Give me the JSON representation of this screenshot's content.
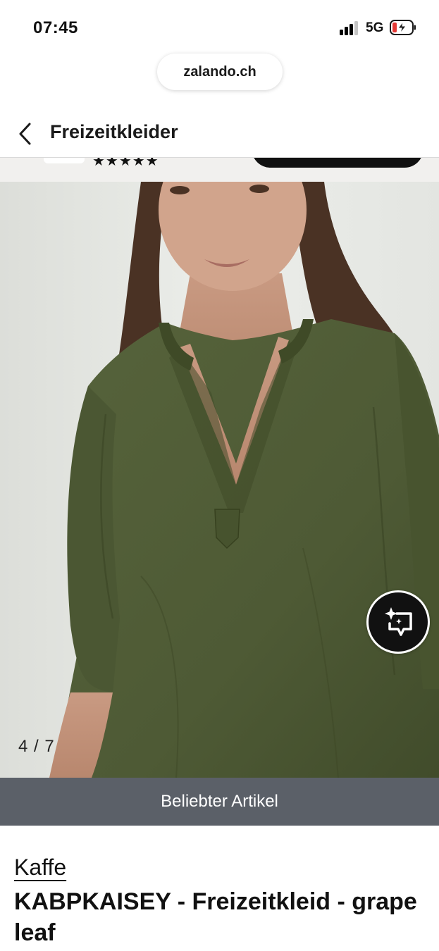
{
  "status_bar": {
    "time": "07:45",
    "network": "5G",
    "signal_bars_active": 3,
    "signal_bars_total": 4,
    "battery": "charging-low"
  },
  "browser": {
    "url": "zalando.ch"
  },
  "header": {
    "back_icon": "chevron-left-icon",
    "title": "Freizeitkleider"
  },
  "gallery": {
    "counter": "4 / 7",
    "current_index": 4,
    "total": 7,
    "ai_button_icon": "sparkle-speech-icon"
  },
  "banner": {
    "label": "Beliebter Artikel"
  },
  "product": {
    "brand": "Kaffe",
    "name": "KABPKAISEY - Freizeitkleid - grape leaf"
  },
  "colors": {
    "banner_bg": "#5b6068",
    "dress": "#4e5a35",
    "accent": "#111111"
  }
}
